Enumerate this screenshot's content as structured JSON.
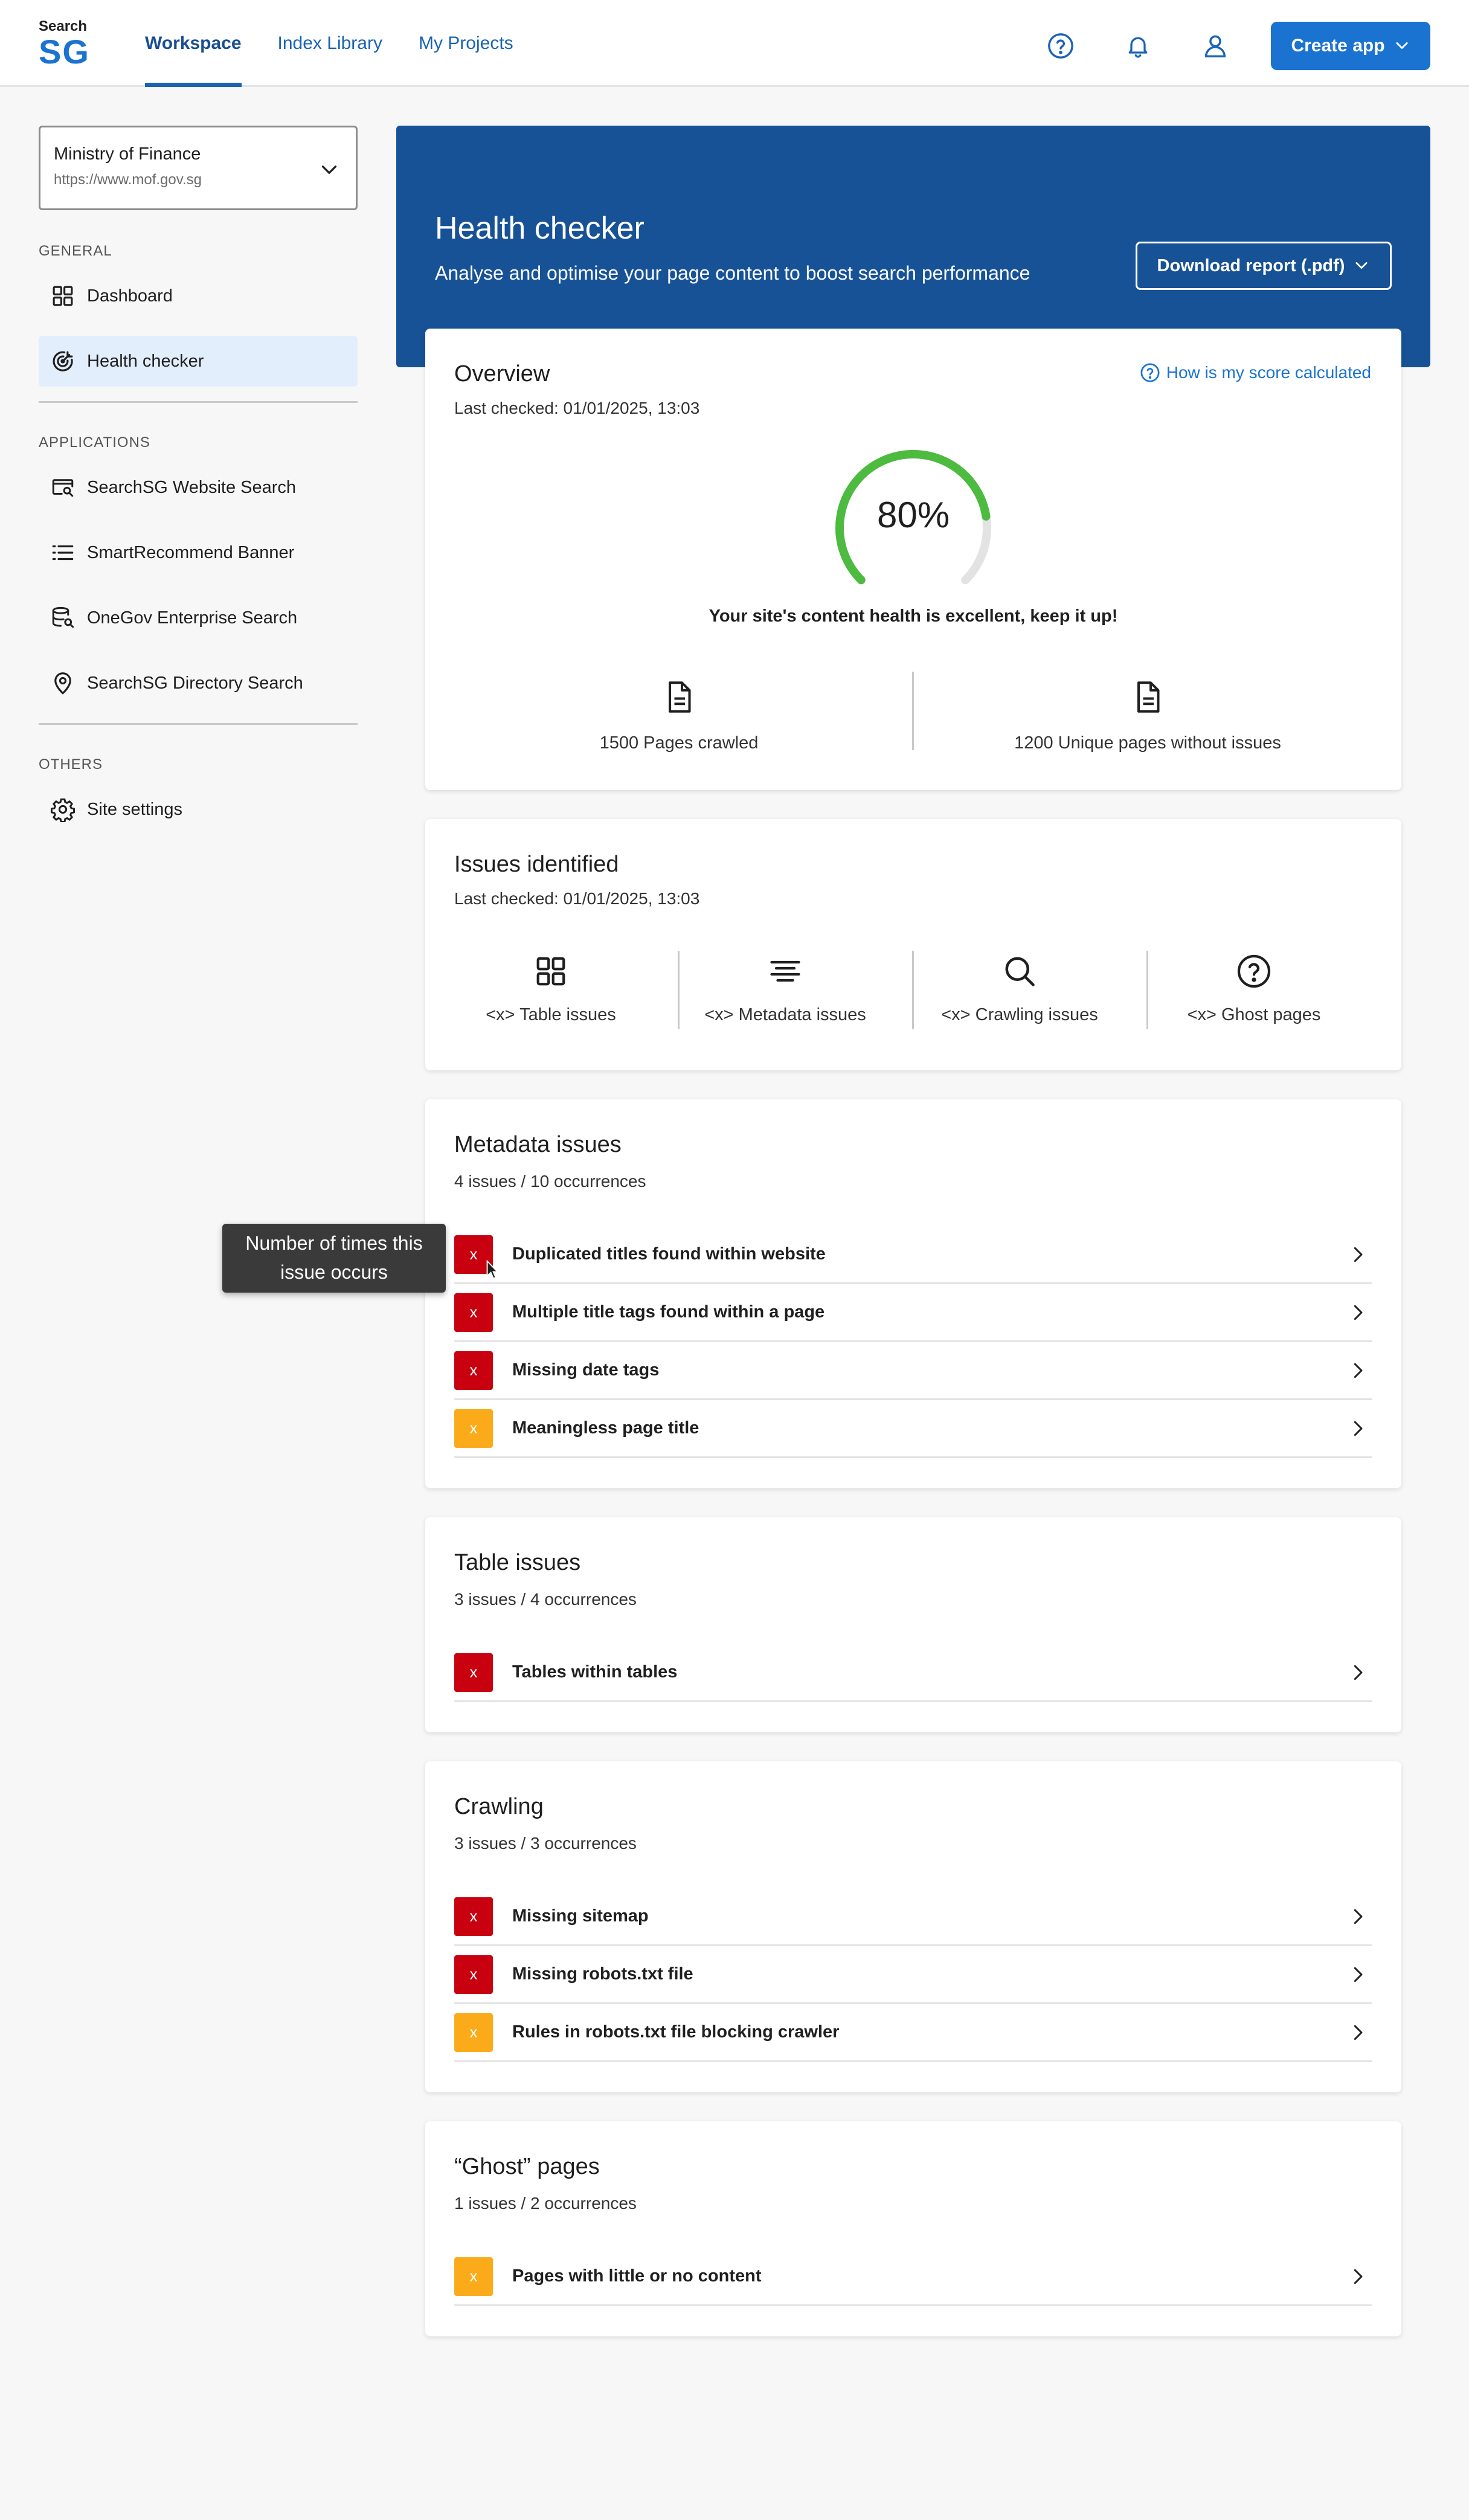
{
  "colors": {
    "primary": "#1a73d1",
    "banner": "#175297",
    "gauge_green": "#4cbb3f",
    "badge_red": "#c8000f",
    "badge_orange": "#fbab19"
  },
  "header": {
    "logo_top": "Search",
    "logo_main": "SG",
    "tabs": [
      {
        "label": "Workspace",
        "active": true
      },
      {
        "label": "Index Library",
        "active": false
      },
      {
        "label": "My Projects",
        "active": false
      }
    ],
    "icons": [
      "help-icon",
      "bell-icon",
      "user-icon"
    ],
    "create_button": "Create app"
  },
  "sidebar": {
    "org": {
      "name": "Ministry of Finance",
      "url": "https://www.mof.gov.sg"
    },
    "sections": {
      "general": "GENERAL",
      "applications": "APPLICATIONS",
      "others": "OTHERS"
    },
    "general_items": [
      {
        "label": "Dashboard",
        "icon": "grid-icon"
      },
      {
        "label": "Health checker",
        "icon": "target-icon",
        "active": true
      }
    ],
    "application_items": [
      {
        "label": "SearchSG Website Search",
        "icon": "browser-search-icon"
      },
      {
        "label": "SmartRecommend Banner",
        "icon": "list-icon"
      },
      {
        "label": "OneGov Enterprise Search",
        "icon": "database-search-icon"
      },
      {
        "label": "SearchSG Directory Search",
        "icon": "location-pin-icon"
      }
    ],
    "other_items": [
      {
        "label": "Site settings",
        "icon": "gear-icon"
      }
    ]
  },
  "banner": {
    "title": "Health checker",
    "subtitle": "Analyse and optimise your page content to boost search performance",
    "download_button": "Download report (.pdf)"
  },
  "overview": {
    "title": "Overview",
    "last_checked": "Last checked: 01/01/2025, 13:03",
    "score_link": "How is my score calculated",
    "score_text": "80%",
    "score_value": 80,
    "message": "Your site's content health is excellent, keep it up!",
    "pages_crawled": "1500 Pages crawled",
    "unique_pages": "1200 Unique pages without issues"
  },
  "issues_identified": {
    "title": "Issues identified",
    "last_checked": "Last checked: 01/01/2025, 13:03",
    "items": [
      {
        "label": "<x> Table issues",
        "icon": "grid-icon"
      },
      {
        "label": "<x> Metadata issues",
        "icon": "align-center-icon"
      },
      {
        "label": "<x> Crawling issues",
        "icon": "search-icon"
      },
      {
        "label": "<x> Ghost pages",
        "icon": "question-circle-icon"
      }
    ]
  },
  "metadata": {
    "title": "Metadata issues",
    "summary": "4 issues / 10 occurrences",
    "rows": [
      {
        "badge": "x",
        "severity": "red",
        "label": "Duplicated titles found within website"
      },
      {
        "badge": "x",
        "severity": "red",
        "label": "Multiple title tags found within a page"
      },
      {
        "badge": "x",
        "severity": "red",
        "label": "Missing date tags"
      },
      {
        "badge": "x",
        "severity": "orange",
        "label": "Meaningless page title"
      }
    ]
  },
  "table_issues": {
    "title": "Table issues",
    "summary": "3 issues / 4 occurrences",
    "rows": [
      {
        "badge": "x",
        "severity": "red",
        "label": "Tables within tables"
      }
    ]
  },
  "crawling": {
    "title": "Crawling",
    "summary": "3 issues / 3 occurrences",
    "rows": [
      {
        "badge": "x",
        "severity": "red",
        "label": "Missing sitemap"
      },
      {
        "badge": "x",
        "severity": "red",
        "label": "Missing robots.txt file"
      },
      {
        "badge": "x",
        "severity": "orange",
        "label": "Rules in robots.txt file blocking crawler"
      }
    ]
  },
  "ghost": {
    "title": "“Ghost” pages",
    "summary": "1 issues / 2 occurrences",
    "rows": [
      {
        "badge": "x",
        "severity": "orange",
        "label": "Pages with little or no content"
      }
    ]
  },
  "tooltip": {
    "line1": "Number of times this",
    "line2": "issue occurs"
  }
}
